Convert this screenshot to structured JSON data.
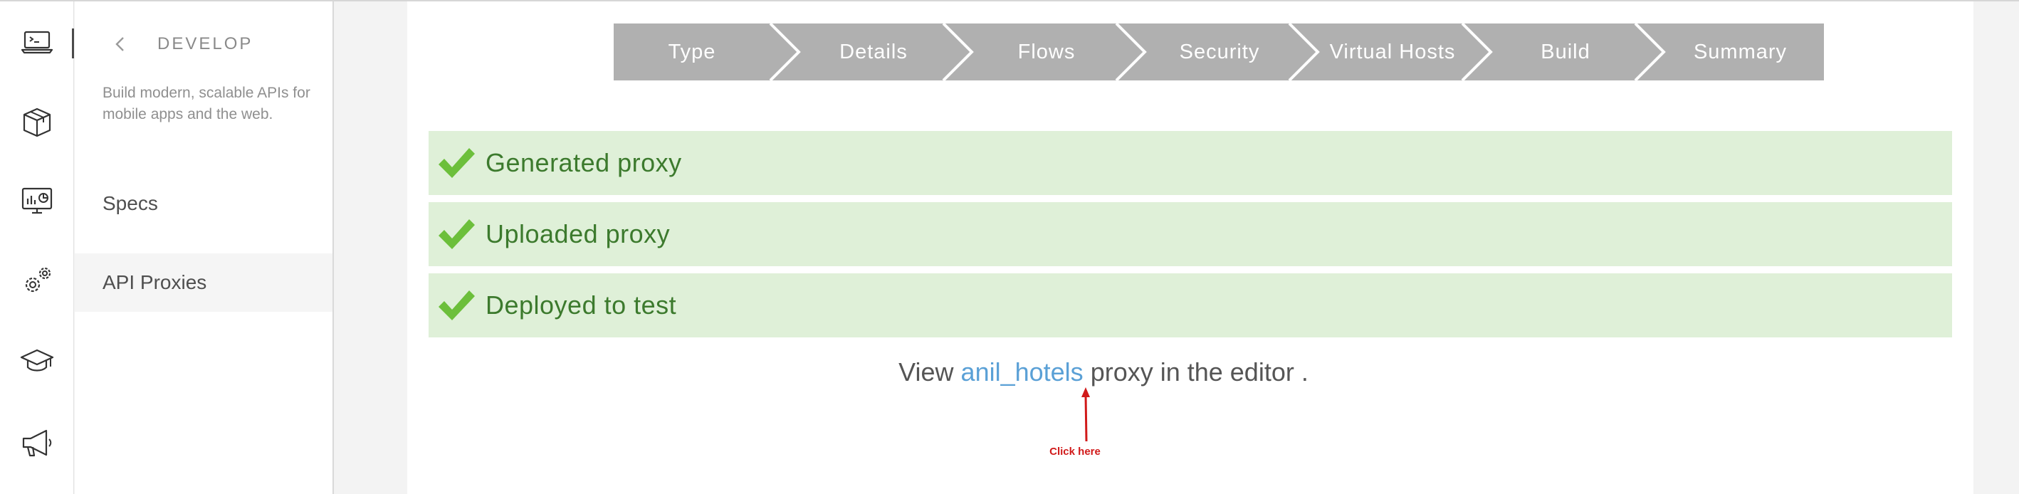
{
  "rail": {
    "items": [
      {
        "icon": "terminal-laptop-icon",
        "active": true
      },
      {
        "icon": "package-box-icon",
        "active": false
      },
      {
        "icon": "analytics-monitor-icon",
        "active": false
      },
      {
        "icon": "gears-icon",
        "active": false
      },
      {
        "icon": "graduation-cap-icon",
        "active": false
      },
      {
        "icon": "megaphone-icon",
        "active": false
      }
    ]
  },
  "subnav": {
    "title": "DEVELOP",
    "description": "Build modern, scalable APIs for mobile apps and the web.",
    "items": [
      {
        "label": "Specs",
        "active": false
      },
      {
        "label": "API Proxies",
        "active": true
      }
    ]
  },
  "wizard": {
    "steps": [
      "Type",
      "Details",
      "Flows",
      "Security",
      "Virtual Hosts",
      "Build",
      "Summary"
    ],
    "color": "#b0b0b0"
  },
  "status": {
    "items": [
      "Generated proxy",
      "Uploaded proxy",
      "Deployed to test"
    ],
    "bg_color": "#dff0d8",
    "text_color": "#3c7a2d",
    "check_color": "#6cbf3b"
  },
  "view": {
    "prefix": "View",
    "link": "anil_hotels",
    "suffix": "proxy in the editor ."
  },
  "annotation": {
    "text": "Click here",
    "color": "#d11a1a"
  }
}
